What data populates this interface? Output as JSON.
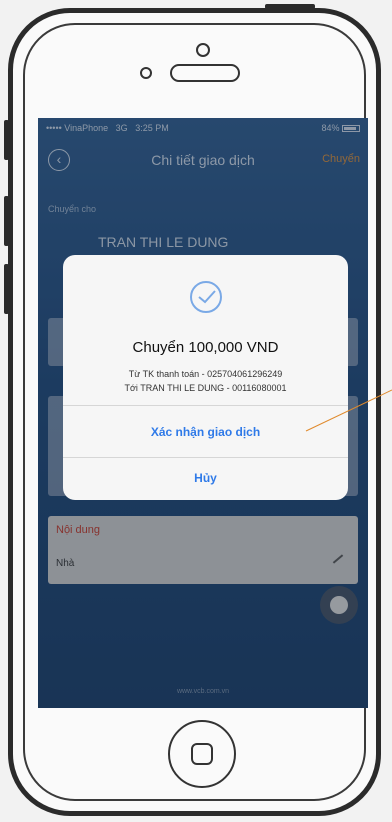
{
  "statusbar": {
    "carrier": "••••• VinaPhone",
    "network": "3G",
    "time": "3:25 PM",
    "battery": "84%"
  },
  "navbar": {
    "back_icon": "chevron-left-circle-icon",
    "title": "Chi tiết giao dịch",
    "action": "Chuyển"
  },
  "transfer": {
    "to_label": "Chuyển cho",
    "recipient_name": "TRAN THI LE DUNG"
  },
  "content": {
    "label": "Nội dung",
    "value": "Nhà"
  },
  "footer": {
    "text": "www.vcb.com.vn"
  },
  "dialog": {
    "icon": "check-circle-icon",
    "title": "Chuyển 100,000 VND",
    "from_line": "Từ TK thanh toán - 025704061296249",
    "to_line": "Tới TRAN THI LE DUNG - 00116080001",
    "confirm_label": "Xác nhận giao dịch",
    "cancel_label": "Hủy"
  },
  "colors": {
    "accent_blue": "#2f7ae8",
    "nav_action": "#d28a3b",
    "annotation": "#e08a2c"
  }
}
